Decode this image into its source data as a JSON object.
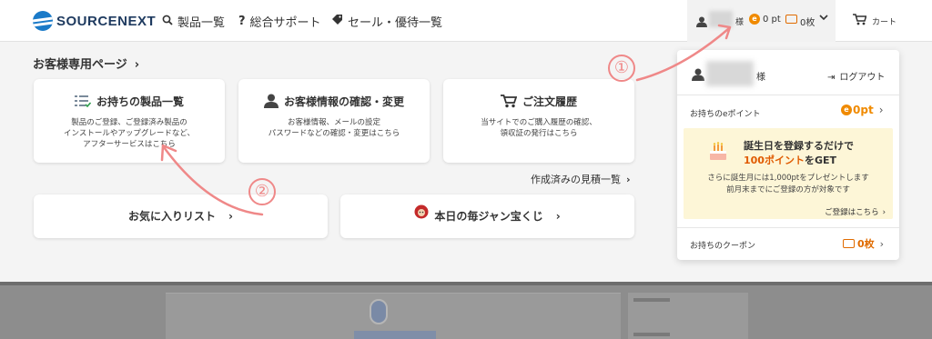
{
  "header": {
    "logo_text": "SOURCENEXT",
    "nav": [
      {
        "icon": "search-icon",
        "label": "製品一覧"
      },
      {
        "icon": "question-icon",
        "label": "総合サポート"
      },
      {
        "icon": "tag-icon",
        "label": "セール・優待一覧"
      }
    ],
    "user": {
      "suffix": "様",
      "points": "0 pt",
      "coupons": "0枚"
    },
    "cart_label": "カート"
  },
  "main": {
    "title": "お客様専用ページ",
    "cards": [
      {
        "title": "お持ちの製品一覧",
        "icon": "product-list-icon",
        "desc": [
          "製品のご登録、ご登録済み製品の",
          "インストールやアップグレードなど、",
          "アフターサービスはこちら"
        ]
      },
      {
        "title": "お客様情報の確認・変更",
        "icon": "person-icon",
        "desc": [
          "お客様情報、メールの設定",
          "パスワードなどの確認・変更はこちら"
        ]
      },
      {
        "title": "ご注文履歴",
        "icon": "cart-icon",
        "desc": [
          "当サイトでのご購入履歴の確認、",
          "領収証の発行はこちら"
        ]
      }
    ],
    "estimate_link": "作成済みの見積一覧",
    "links": [
      {
        "label": "お気に入りリスト"
      },
      {
        "label": "本日の毎ジャン宝くじ"
      }
    ]
  },
  "dropdown": {
    "suffix": "様",
    "logout": "ログアウト",
    "epoint_label": "お持ちのeポイント",
    "epoint_value": "0pt",
    "birthday": {
      "line1": "誕生日を登録するだけで",
      "highlight": "100ポイント",
      "line2_rest": "をGET",
      "desc": [
        "さらに誕生月には1,000ptをプレゼントします",
        "前月末までにご登録の方が対象です"
      ],
      "link": "ご登録はこちら"
    },
    "coupon_label": "お持ちのクーポン",
    "coupon_value": "0枚"
  },
  "annotations": {
    "one": "①",
    "two": "②"
  },
  "colors": {
    "accent": "#f08a00",
    "annotation": "#ef8888",
    "brand": "#1a7ac8"
  }
}
